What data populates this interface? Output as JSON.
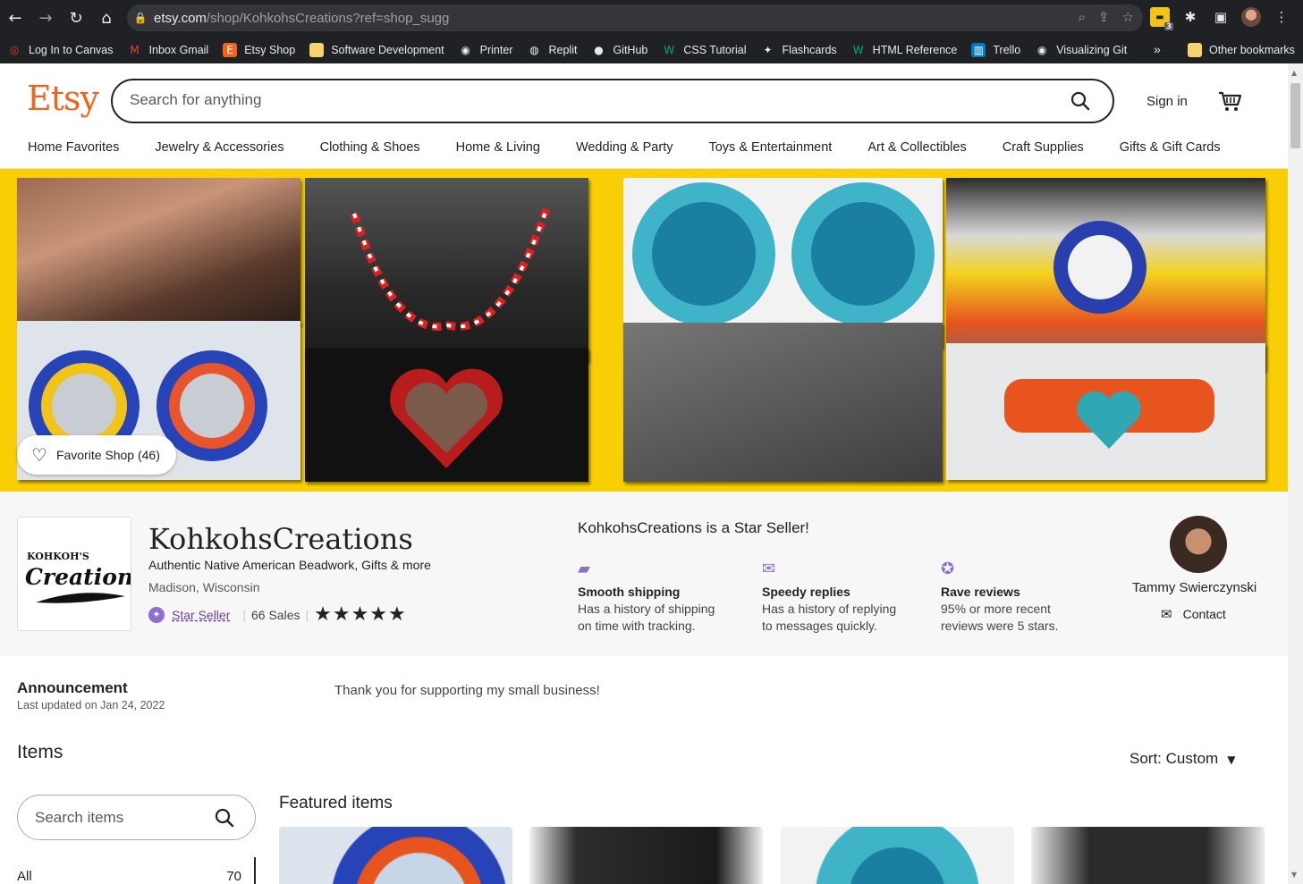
{
  "browser": {
    "url_host": "etsy.com",
    "url_path": "/shop/KohkohsCreations?ref=shop_sugg",
    "extension_badge": "3",
    "bookmarks": [
      {
        "label": "Log In to Canvas",
        "icon": "canvas-icon",
        "color": "#e13f2b"
      },
      {
        "label": "Inbox Gmail",
        "icon": "gmail-icon",
        "color": "#ea4335"
      },
      {
        "label": "Etsy Shop",
        "icon": "etsy-icon",
        "color": "#f1641e"
      },
      {
        "label": "Software Development",
        "icon": "folder-icon",
        "color": "#f6d36b"
      },
      {
        "label": "Printer",
        "icon": "globe-icon",
        "color": "#e8eaed"
      },
      {
        "label": "Replit",
        "icon": "replit-icon",
        "color": "#e8eaed"
      },
      {
        "label": "GitHub",
        "icon": "github-icon",
        "color": "#e8eaed"
      },
      {
        "label": "CSS Tutorial",
        "icon": "w3schools-icon",
        "color": "#04aa6d"
      },
      {
        "label": "Flashcards",
        "icon": "flashcards-icon",
        "color": "#e8eaed"
      },
      {
        "label": "HTML Reference",
        "icon": "w3schools-icon",
        "color": "#04aa6d"
      },
      {
        "label": "Trello",
        "icon": "trello-icon",
        "color": "#0079bf"
      },
      {
        "label": "Visualizing Git",
        "icon": "globe-icon",
        "color": "#e8eaed"
      }
    ],
    "bookmarks_more": "»",
    "other_bookmarks": "Other bookmarks"
  },
  "header": {
    "logo": "Etsy",
    "search_placeholder": "Search for anything",
    "sign_in": "Sign in",
    "categories": [
      "Home Favorites",
      "Jewelry & Accessories",
      "Clothing & Shoes",
      "Home & Living",
      "Wedding & Party",
      "Toys & Entertainment",
      "Art & Collectibles",
      "Craft Supplies",
      "Gifts & Gift Cards"
    ]
  },
  "banner": {
    "favorite_label": "Favorite Shop (46)"
  },
  "shop": {
    "name": "KohkohsCreations",
    "tagline": "Authentic Native American Beadwork, Gifts & more",
    "location": "Madison, Wisconsin",
    "star_seller": "Star Seller",
    "sales": "66 Sales",
    "rating": 5,
    "stars": "★★★★★",
    "star_heading": "KohkohsCreations is a Star Seller!",
    "perks": [
      {
        "title": "Smooth shipping",
        "desc1": "Has a history of shipping",
        "desc2": "on time with tracking.",
        "icon": "truck-icon"
      },
      {
        "title": "Speedy replies",
        "desc1": "Has a history of replying",
        "desc2": "to messages quickly.",
        "icon": "envelope-icon"
      },
      {
        "title": "Rave reviews",
        "desc1": "95% or more recent",
        "desc2": "reviews were 5 stars.",
        "icon": "star-badge-icon"
      }
    ],
    "owner": "Tammy Swierczynski",
    "contact": "Contact",
    "accent_color": "#f1641e",
    "star_seller_color": "#8e6ecf"
  },
  "announcement": {
    "title": "Announcement",
    "updated": "Last updated on Jan 24, 2022",
    "text": "Thank you for supporting my small business!"
  },
  "items": {
    "title": "Items",
    "sort": "Sort: Custom",
    "search_placeholder": "Search items",
    "all_label": "All",
    "all_count": "70",
    "featured_title": "Featured items"
  }
}
